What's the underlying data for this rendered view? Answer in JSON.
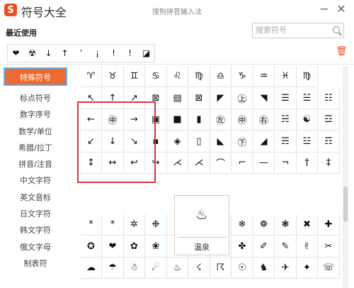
{
  "window": {
    "app_name": "符号大全",
    "center_title": "搜狗拼音输入法",
    "logo": "S"
  },
  "recent": {
    "title": "最近使用",
    "symbols": [
      "❤",
      "☢",
      "↓",
      "↑",
      "’",
      "¡",
      "!",
      "!",
      "◪"
    ]
  },
  "search": {
    "placeholder": "搜索符号"
  },
  "sidebar": {
    "items": [
      {
        "label": "特殊符号",
        "active": true
      },
      {
        "label": "标点符号"
      },
      {
        "label": "数字序号"
      },
      {
        "label": "数学/单位"
      },
      {
        "label": "希腊/拉丁"
      },
      {
        "label": "拼音/注音"
      },
      {
        "label": "中文字符"
      },
      {
        "label": "英文音标"
      },
      {
        "label": "日文字符"
      },
      {
        "label": "韩文字符"
      },
      {
        "label": "俄文字母"
      },
      {
        "label": "制表符"
      }
    ]
  },
  "grid_top": {
    "rows": [
      [
        "♈",
        "♉",
        "♊",
        "♋",
        "♌",
        "♍",
        "♎",
        "♑",
        "♒",
        "♓",
        "♍"
      ],
      [
        "↖",
        "↑",
        "↗",
        "⊠",
        "▤",
        "⊠",
        "◤",
        "㊤",
        "◥",
        "☰",
        "☱",
        "☷"
      ],
      [
        "←",
        "㊥",
        "→",
        "▣",
        "■",
        "▮",
        "㊧",
        "㊥",
        "㊨",
        "☵",
        "☯",
        "☲"
      ],
      [
        "↙",
        "↓",
        "↘",
        "▪",
        "◈",
        "▯",
        "◣",
        "㊦",
        "◢",
        "☴",
        "☳",
        "☶"
      ],
      [
        "↕",
        "↔",
        "↩",
        "↪",
        "⋌",
        "⋌",
        "⌒",
        "⌐",
        "—",
        "¬",
        "†",
        "‡"
      ]
    ]
  },
  "grid_bottom": {
    "rows": [
      [
        "*",
        "*",
        "✲",
        "❉",
        "✻",
        "✼",
        "✽",
        "❄",
        "❁",
        "❃",
        "✖",
        "✚"
      ],
      [
        "✪",
        "❤",
        "✿",
        "❀",
        "✾",
        "♠",
        "☼",
        "✤",
        "✐",
        "✎",
        "✌",
        "✂"
      ],
      [
        "☁",
        "☂",
        "☃",
        "☄",
        "♨",
        "☇",
        "☈",
        "☉",
        "♞",
        "✈",
        "✦",
        "☏"
      ]
    ]
  },
  "tooltip": {
    "symbol": "♨",
    "label": "温泉"
  }
}
